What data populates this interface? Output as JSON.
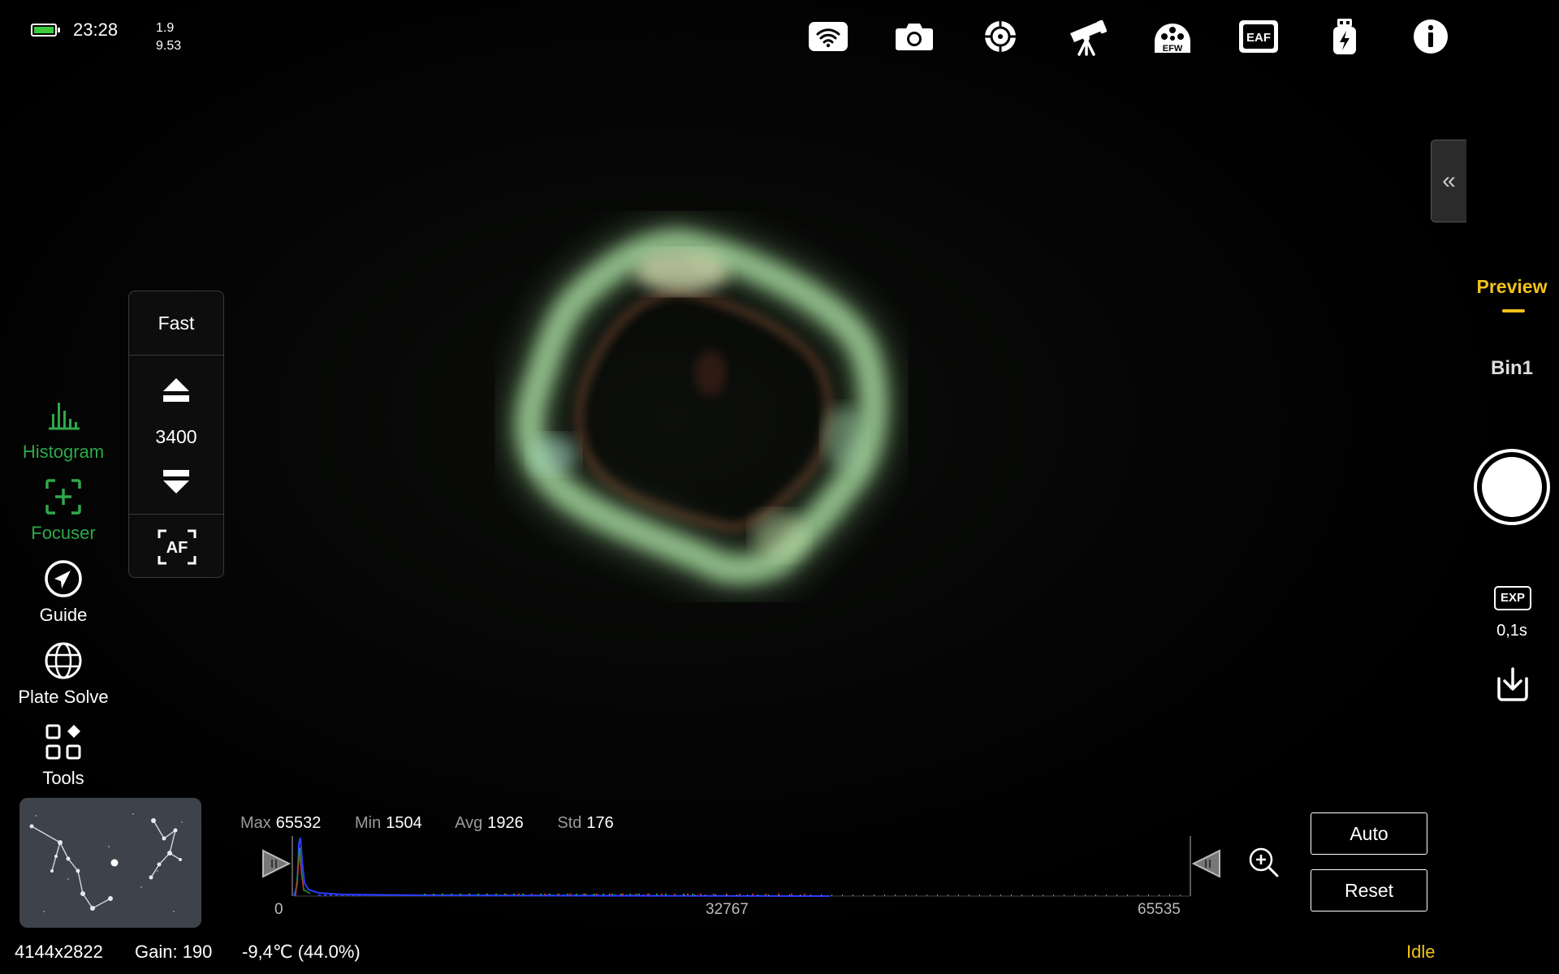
{
  "status": {
    "time": "23:28",
    "version_line1": "1.9",
    "version_line2": "9.53"
  },
  "top_icons": [
    "wifi-icon",
    "camera-icon",
    "crosshair-icon",
    "telescope-icon",
    "efw-icon",
    "eaf-icon",
    "usb-power-icon",
    "info-icon"
  ],
  "top_icon_labels": {
    "efw": "EFW",
    "eaf": "EAF"
  },
  "right_panel": {
    "mode": "Preview",
    "bin": "Bin1",
    "exp_badge": "EXP",
    "exposure": "0,1s"
  },
  "focuser_panel": {
    "speed": "Fast",
    "position": "3400",
    "af_label": "AF"
  },
  "nav": [
    {
      "label": "Histogram",
      "active": true
    },
    {
      "label": "Focuser",
      "active": true
    },
    {
      "label": "Guide",
      "active": false
    },
    {
      "label": "Plate Solve",
      "active": false
    },
    {
      "label": "Tools",
      "active": false
    }
  ],
  "histogram": {
    "stats": {
      "max_label": "Max",
      "max": "65532",
      "min_label": "Min",
      "min": "1504",
      "avg_label": "Avg",
      "avg": "1926",
      "std_label": "Std",
      "std": "176"
    },
    "ticks": [
      "0",
      "32767",
      "65535"
    ]
  },
  "buttons": {
    "auto": "Auto",
    "reset": "Reset"
  },
  "footer": {
    "resolution": "4144x2822",
    "gain": "Gain: 190",
    "temperature": "-9,4℃  (44.0%)",
    "state": "Idle"
  },
  "colors": {
    "accent_green": "#2fa84a",
    "accent_yellow": "#f2c21a",
    "background": "#000000"
  }
}
